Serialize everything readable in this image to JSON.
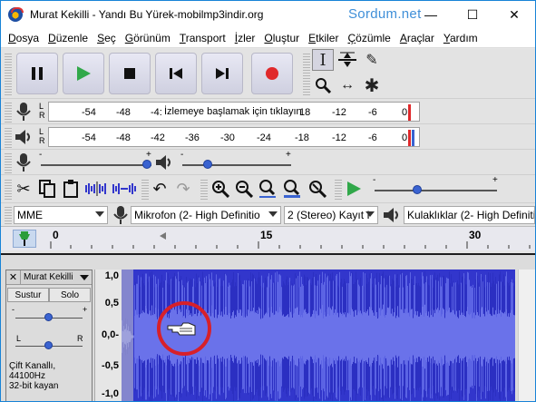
{
  "window": {
    "title": "Murat Kekilli - Yandı Bu Yürek-mobilmp3indir.org",
    "watermark": "Sordum.net",
    "minimize": "—",
    "maximize": "☐",
    "close": "✕"
  },
  "menu": [
    {
      "first": "D",
      "rest": "osya"
    },
    {
      "first": "D",
      "rest": "üzenle"
    },
    {
      "first": "S",
      "rest": "eç"
    },
    {
      "first": "G",
      "rest": "örünüm"
    },
    {
      "first": "T",
      "rest": "ransport"
    },
    {
      "first": "İ",
      "rest": "zler"
    },
    {
      "first": "O",
      "rest": "luştur"
    },
    {
      "first": "E",
      "rest": "tkiler"
    },
    {
      "first": "Ç",
      "rest": "özümle"
    },
    {
      "first": "A",
      "rest": "raçlar"
    },
    {
      "first": "Y",
      "rest": "ardım"
    }
  ],
  "transport": {
    "icons": [
      "pause-icon",
      "play-icon",
      "stop-icon",
      "skip-to-start-icon",
      "skip-to-end-icon",
      "record-icon"
    ]
  },
  "tools": {
    "icons": [
      "selection-tool-icon",
      "envelope-tool-icon",
      "draw-tool-icon",
      "zoom-tool-icon",
      "time-shift-tool-icon",
      "multi-tool-icon"
    ]
  },
  "record_meter": {
    "ticks": [
      "-54",
      "-48",
      "-4:",
      "18",
      "-12",
      "-6",
      "0"
    ],
    "prompt": "İzlemeye başlamak için tıklayın",
    "channels": [
      "L",
      "R"
    ]
  },
  "playback_meter": {
    "ticks": [
      "-54",
      "-48",
      "-42",
      "-36",
      "-30",
      "-24",
      "-18",
      "-12",
      "-6",
      "0"
    ],
    "channels": [
      "L",
      "R"
    ]
  },
  "mixer": {
    "record_volume_minus": "-",
    "record_volume_plus": "+",
    "record_volume_level": 0.96,
    "playback_volume_minus": "-",
    "playback_volume_plus": "+",
    "playback_volume_level": 0.23
  },
  "play_at_speed": {
    "minus": "-",
    "plus": "+",
    "level": 0.35
  },
  "devices": {
    "host": "MME",
    "recording_device": "Mikrofon (2- High Definitio",
    "channels": "2 (Stereo) Kayıt I",
    "playback_device": "Kulaklıklar (2- High Definiti"
  },
  "timeline": {
    "labels": [
      "0",
      "15",
      "30"
    ]
  },
  "track": {
    "name": "Murat Kekilli",
    "mute": "Sustur",
    "solo": "Solo",
    "gain_minus": "-",
    "gain_plus": "+",
    "gain_level": 0.5,
    "pan_left": "L",
    "pan_right": "R",
    "pan_level": 0.5,
    "info_line1": "Çift Kanallı, 44100Hz",
    "info_line2": "32-bit kayan",
    "vruler": [
      "1,0",
      "0,5",
      "0,0-",
      "-0,5",
      "-1,0"
    ]
  },
  "colors": {
    "waveform": "#3236cc",
    "waveform_light": "#5b63e4",
    "highlight_circle": "#d7202a",
    "record_button": "#e0292b",
    "play_button": "#31a84a"
  }
}
